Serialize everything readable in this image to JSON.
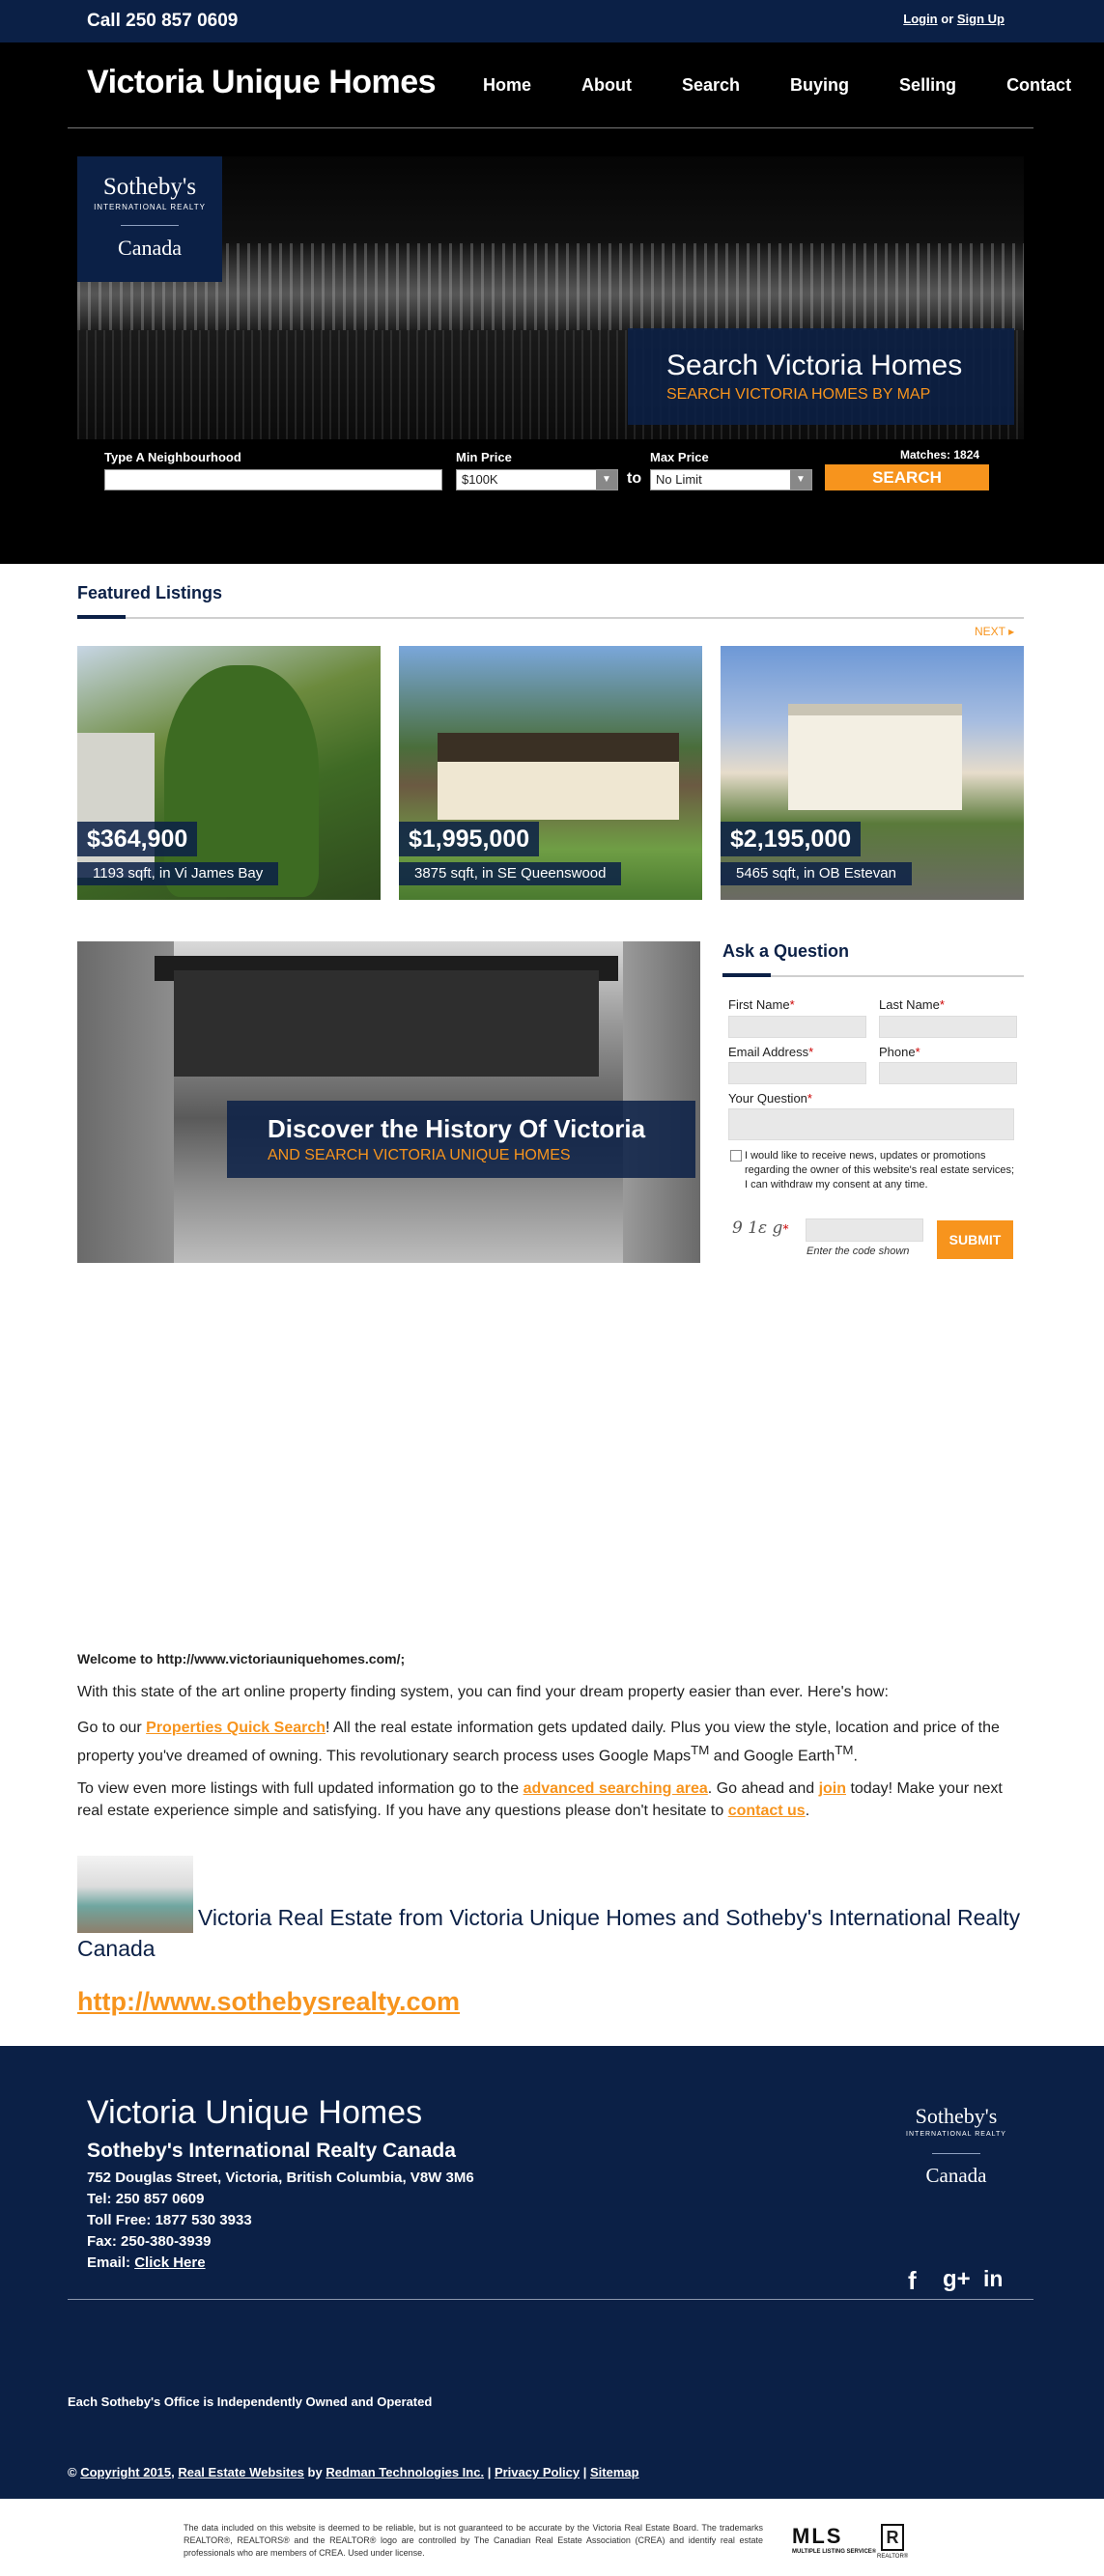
{
  "topbar": {
    "phone": "Call 250 857 0609",
    "login": "Login",
    "or": "or",
    "signup": "Sign Up"
  },
  "header": {
    "title": "Victoria Unique Homes",
    "nav": [
      "Home",
      "About",
      "Search",
      "Buying",
      "Selling",
      "Contact"
    ]
  },
  "hero": {
    "brand": {
      "name": "Sotheby's",
      "sub": "INTERNATIONAL REALTY",
      "country": "Canada"
    },
    "promo_title": "Search Victoria Homes",
    "promo_sub": "SEARCH VICTORIA HOMES BY MAP",
    "search": {
      "neighbourhood_label": "Type A Neighbourhood",
      "neighbourhood_value": "",
      "min_label": "Min Price",
      "min_value": "$100K",
      "to": "to",
      "max_label": "Max Price",
      "max_value": "No Limit",
      "matches_label": "Matches:",
      "matches_count": "1824",
      "button": "SEARCH"
    }
  },
  "featured": {
    "title": "Featured Listings",
    "next": "NEXT",
    "listings": [
      {
        "price": "$364,900",
        "detail": "1193 sqft, in Vi James Bay"
      },
      {
        "price": "$1,995,000",
        "detail": "3875 sqft, in SE Queenswood"
      },
      {
        "price": "$2,195,000",
        "detail": "5465 sqft, in OB Estevan"
      }
    ]
  },
  "discover": {
    "title": "Discover the History Of Victoria",
    "sub": "AND SEARCH VICTORIA UNIQUE HOMES"
  },
  "ask": {
    "title": "Ask a Question",
    "first_name": "First Name",
    "last_name": "Last Name",
    "email": "Email Address",
    "phone": "Phone",
    "question": "Your Question",
    "required_mark": "*",
    "consent": "I would like to receive news, updates or promotions regarding the owner of this website's real estate services; I can withdraw my consent at any time.",
    "captcha_code": "9 1ε g",
    "captcha_hint": "Enter the code shown",
    "submit": "SUBMIT"
  },
  "welcome": {
    "heading": "Welcome to http://www.victoriauniquehomes.com/;",
    "p1": "With this state of the art online property finding system, you can find your dream property easier than ever. Here's how:",
    "p2_pre": "Go to our ",
    "p2_link": "Properties Quick Search",
    "p2_post": "! All the real estate information gets updated daily. Plus you view the style, location and price of the property you've dreamed of owning. This revolutionary search process uses Google Maps",
    "tm": "TM",
    "p2_and": " and Google Earth",
    "p2_end": ".",
    "p3_pre": "To view even more listings with full updated information go to the ",
    "p3_link1": "advanced searching area",
    "p3_mid": ". Go ahead and ",
    "p3_link2": "join",
    "p3_mid2": " today! Make your next real estate experience simple and satisfying. If you have any questions please don't hesitate to ",
    "p3_link3": "contact us",
    "p3_end": ".",
    "caption": "Victoria Real Estate from Victoria Unique Homes and Sotheby's International Realty Canada",
    "big_link": "http://www.sothebysrealty.com"
  },
  "footer": {
    "title": "Victoria Unique Homes",
    "company": "Sotheby's International Realty Canada",
    "address": "752 Douglas Street, Victoria, British Columbia, V8W 3M6",
    "tel_label": "Tel:",
    "tel": "250 857 0609",
    "tollfree_label": "Toll Free:",
    "tollfree": "1877 530 3933",
    "fax_label": "Fax:",
    "fax": "250-380-3939",
    "email_label": "Email:",
    "email_link": "Click Here",
    "brand": {
      "name": "Sotheby's",
      "sub": "INTERNATIONAL REALTY",
      "country": "Canada"
    },
    "social": [
      "f",
      "g+",
      "in"
    ],
    "note": "Each Sotheby's Office is Independently Owned and Operated",
    "copyright_sym": "©",
    "copyright": "Copyright 2015",
    "sites": "Real Estate Websites",
    "by": "by",
    "redman": "Redman Technologies Inc.",
    "privacy": "Privacy Policy",
    "sitemap": "Sitemap"
  },
  "disclaimer": "The data included on this website is deemed to be reliable, but is not guaranteed to be accurate by the Victoria Real Estate Board. The trademarks REALTOR®, REALTORS® and the REALTOR® logo are controlled by The Canadian Real Estate Association (CREA) and identify real estate professionals who are members of CREA. Used under license.",
  "mls": {
    "letters": "MLS",
    "caption": "MULTIPLE LISTING SERVICE®",
    "realtor": "R",
    "realtor_caption": "REALTOR®"
  },
  "colors": {
    "navy": "#0b2046",
    "orange": "#f7941d"
  }
}
